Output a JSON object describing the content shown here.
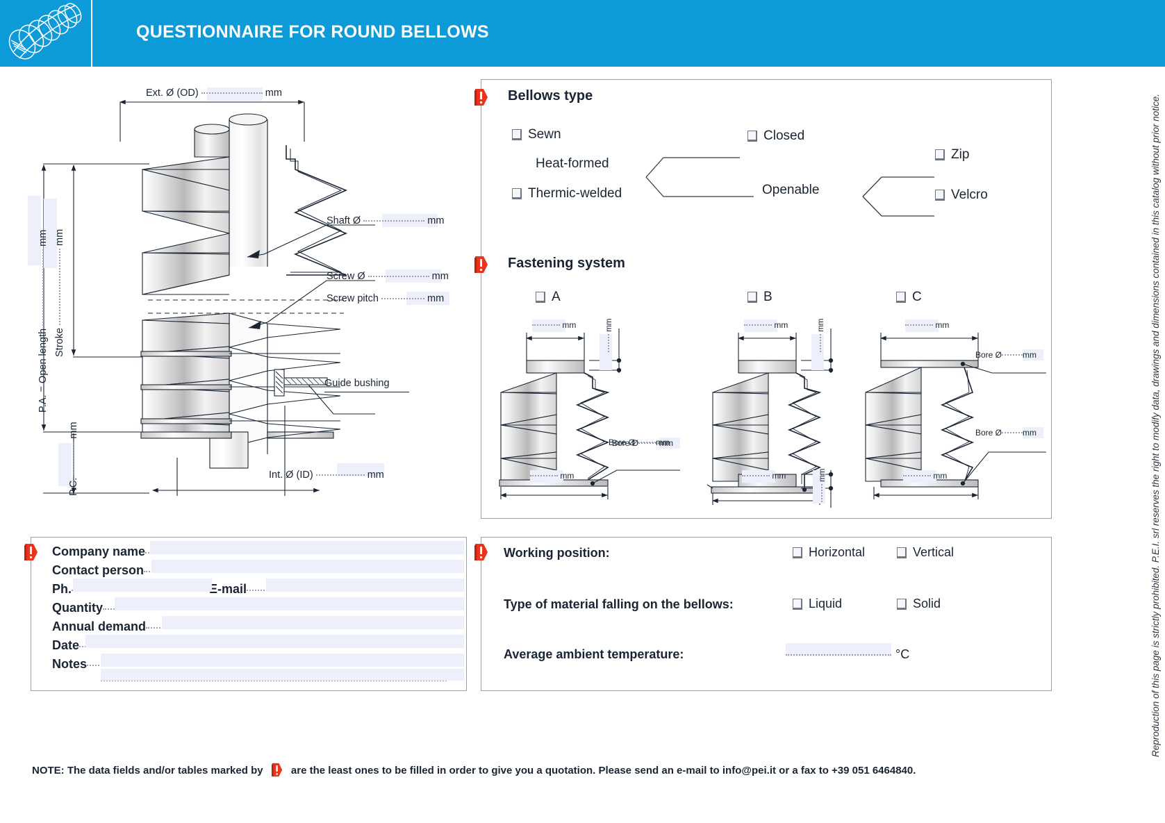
{
  "header": {
    "title": "QUESTIONNAIRE FOR ROUND BELLOWS",
    "logo_icon": "bellows-logo-icon",
    "bg_color": "#0c9ad8"
  },
  "main_drawing": {
    "labels": {
      "ext_diameter": "Ext. Ø (OD)",
      "ext_unit": "mm",
      "shaft_diameter": "Shaft Ø",
      "shaft_unit": "mm",
      "screw_diameter": "Screw Ø",
      "screw_unit": "mm",
      "screw_pitch": "Screw pitch",
      "screw_pitch_unit": "mm",
      "guide_bushing": "Guide bushing",
      "int_diameter": "Int. Ø (ID)",
      "int_unit": "mm",
      "open_length": "P.A. = Open length",
      "open_length_unit": "mm",
      "stroke": "Stroke",
      "stroke_unit": "mm",
      "pc": "P.C.",
      "pc_unit": "mm"
    }
  },
  "bellows_type": {
    "title": "Bellows type",
    "flag_icon": "required-flag-icon",
    "options": [
      {
        "label": "Sewn",
        "checkbox": true
      },
      {
        "label": "Heat-formed",
        "checkbox": false
      },
      {
        "label": "Thermic-welded",
        "checkbox": true
      },
      {
        "label": "Closed",
        "checkbox": true
      },
      {
        "label": "Openable",
        "checkbox": false
      },
      {
        "label": "Zip",
        "checkbox": true
      },
      {
        "label": "Velcro",
        "checkbox": true
      }
    ]
  },
  "fastening_system": {
    "title": "Fastening system",
    "flag_icon": "required-flag-icon",
    "variants": [
      {
        "label": "A",
        "width_unit": "mm",
        "height_unit": "mm",
        "bottom_unit": "mm",
        "bore_label": "Bore Ø",
        "bore_unit": "mm"
      },
      {
        "label": "B",
        "width_unit": "mm",
        "height_unit": "mm",
        "bottom_unit": "mm",
        "bottom_height_unit": "mm",
        "bore_label": "Bore Ø",
        "bore_unit": "mm"
      },
      {
        "label": "C",
        "width_unit": "mm",
        "bottom_unit": "mm",
        "bore_label_top": "Bore Ø",
        "bore_unit_top": "mm",
        "bore_label_bottom": "Bore Ø",
        "bore_unit_bottom": "mm"
      }
    ]
  },
  "contact_form": {
    "flag_icon": "required-flag-icon",
    "fields": [
      {
        "label": "Company name",
        "value": ""
      },
      {
        "label": "Contact person",
        "value": ""
      },
      {
        "label": "Ph.",
        "value": ""
      },
      {
        "label": "E-mail",
        "value": ""
      },
      {
        "label": "Quantity",
        "value": ""
      },
      {
        "label": "Annual demand",
        "value": ""
      },
      {
        "label": "Date",
        "value": ""
      },
      {
        "label": "Notes",
        "value": ""
      }
    ]
  },
  "working_panel": {
    "flag_icon": "required-flag-icon",
    "working_position": {
      "label": "Working position:",
      "options": [
        {
          "label": "Horizontal",
          "checked": false
        },
        {
          "label": "Vertical",
          "checked": false
        }
      ]
    },
    "material_type": {
      "label": "Type of material falling on the bellows:",
      "options": [
        {
          "label": "Liquid",
          "checked": false
        },
        {
          "label": "Solid",
          "checked": false
        }
      ]
    },
    "temperature": {
      "label": "Average ambient temperature:",
      "value": "",
      "unit": "°C"
    }
  },
  "footer": {
    "note_part1": "NOTE: The data fields and/or tables marked by",
    "note_icon": "required-flag-icon",
    "note_part2": "are the least ones to be filled in order to give you a quotation. Please send an e-mail to info@pei.it or a fax to +39 051 6464840."
  },
  "side_copyright": {
    "text": "Reproduction of this page is strictly prohibited. P.E.I. srl reserves the right to modify data, drawings and dimensions contained in this catalog without prior notice."
  },
  "colors": {
    "brand_blue": "#0c9ad8",
    "flag_red": "#e8341c",
    "field_fill": "#edf0fb",
    "panel_border": "#9aa0a6"
  }
}
